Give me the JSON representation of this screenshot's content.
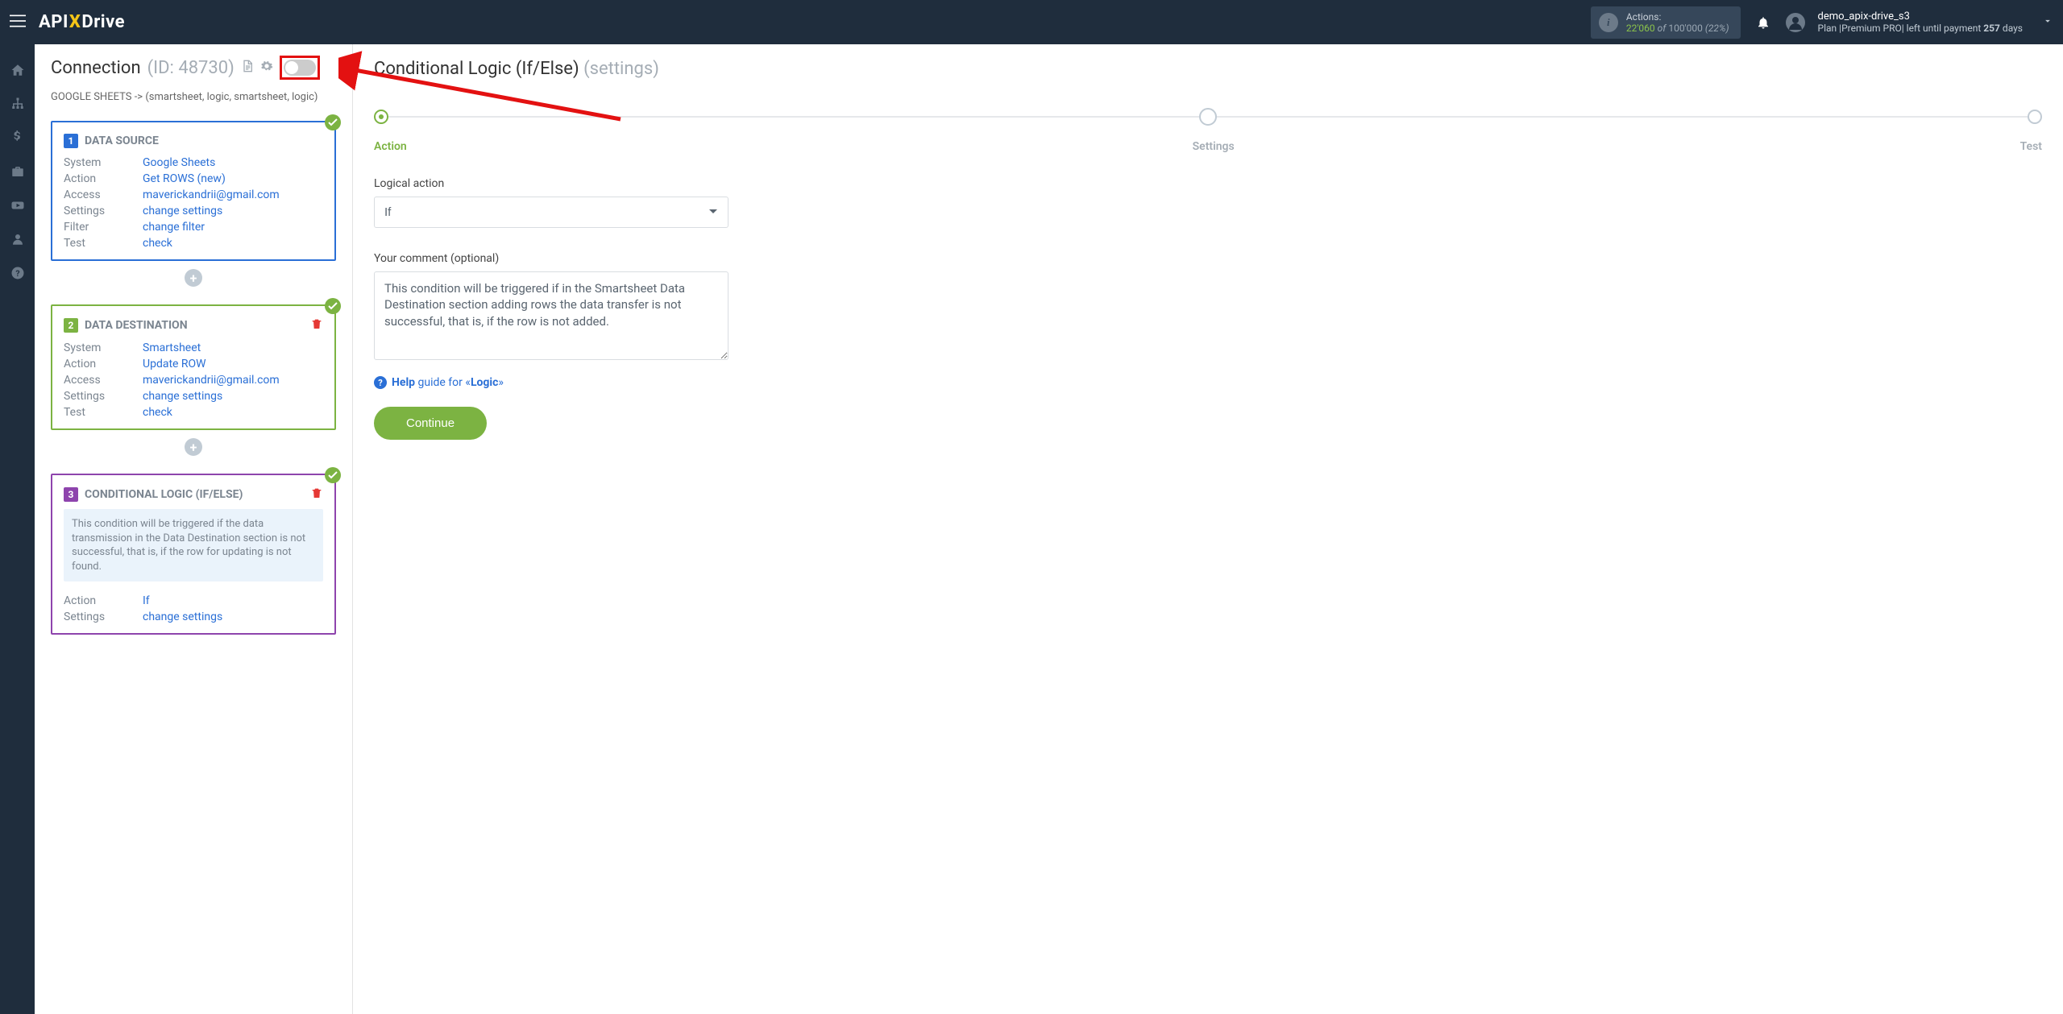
{
  "header": {
    "logo_prefix": "API",
    "logo_x": "X",
    "logo_suffix": "Drive",
    "actions_label": "Actions:",
    "actions_count": "22'060",
    "actions_of": "of",
    "actions_total": "100'000",
    "actions_pct": "(22%)",
    "user_name": "demo_apix-drive_s3",
    "plan_prefix": "Plan |Premium PRO| left until payment",
    "plan_days": "257",
    "plan_suffix": "days"
  },
  "side": {
    "title": "Connection",
    "id": "(ID: 48730)",
    "breadcrumb": "GOOGLE SHEETS -> (smartsheet, logic, smartsheet, logic)",
    "card1": {
      "num": "1",
      "title": "DATA SOURCE",
      "rows": {
        "system_k": "System",
        "system_v": "Google Sheets",
        "action_k": "Action",
        "action_v": "Get ROWS (new)",
        "access_k": "Access",
        "access_v": "maverickandrii@gmail.com",
        "settings_k": "Settings",
        "settings_v": "change settings",
        "filter_k": "Filter",
        "filter_v": "change filter",
        "test_k": "Test",
        "test_v": "check"
      }
    },
    "card2": {
      "num": "2",
      "title": "DATA DESTINATION",
      "rows": {
        "system_k": "System",
        "system_v": "Smartsheet",
        "action_k": "Action",
        "action_v": "Update ROW",
        "access_k": "Access",
        "access_v": "maverickandrii@gmail.com",
        "settings_k": "Settings",
        "settings_v": "change settings",
        "test_k": "Test",
        "test_v": "check"
      }
    },
    "card3": {
      "num": "3",
      "title": "CONDITIONAL LOGIC (IF/ELSE)",
      "note": "This condition will be triggered if the data transmission in the Data Destination section is not successful, that is, if the row for updating is not found.",
      "rows": {
        "action_k": "Action",
        "action_v": "If",
        "settings_k": "Settings",
        "settings_v": "change settings"
      }
    }
  },
  "content": {
    "title": "Conditional Logic (If/Else)",
    "title_sub": "(settings)",
    "steps": {
      "s1": "Action",
      "s2": "Settings",
      "s3": "Test"
    },
    "logical_label": "Logical action",
    "logical_value": "If",
    "comment_label": "Your comment (optional)",
    "comment_value": "This condition will be triggered if in the Smartsheet Data Destination section adding rows the data transfer is not successful, that is, if the row is not added.",
    "help_text1": "Help",
    "help_text2": "guide for «",
    "help_bold": "Logic",
    "help_text3": "»",
    "continue": "Continue"
  }
}
